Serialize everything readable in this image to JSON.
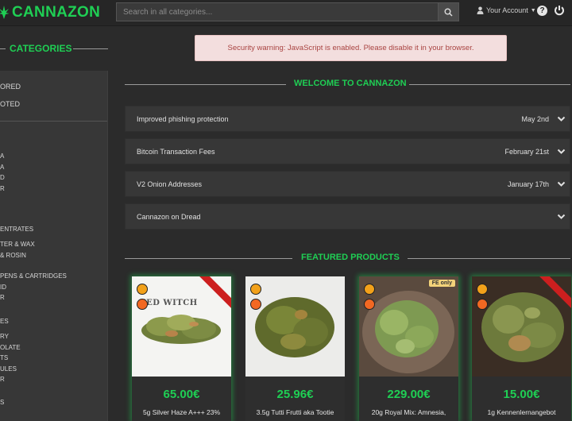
{
  "header": {
    "brand": "CANNAZON",
    "search_placeholder": "Search in all categories...",
    "account_label": "Your Account"
  },
  "sidebar": {
    "title": "CATEGORIES",
    "items": [
      "ORED",
      "OTED",
      "A",
      "A",
      "D",
      "R",
      "ENTRATES",
      "TER & WAX",
      "& ROSIN",
      "PENS & CARTRIDGES",
      "ID",
      "R",
      "ES",
      "RY",
      "OLATE",
      "TS",
      "ULES",
      "R",
      "S"
    ]
  },
  "alert": {
    "text": "Security warning: JavaScript is enabled. Please disable it in your browser."
  },
  "welcome": {
    "title": "WELCOME TO CANNAZON"
  },
  "news": [
    {
      "title": "Improved phishing protection",
      "date": "May 2nd"
    },
    {
      "title": "Bitcoin Transaction Fees",
      "date": "February 21st"
    },
    {
      "title": "V2 Onion Addresses",
      "date": "January 17th"
    },
    {
      "title": "Cannazon on Dread",
      "date": ""
    }
  ],
  "featured": {
    "title": "FEATURED PRODUCTS",
    "products": [
      {
        "price": "65.00€",
        "name": "5g Silver Haze A+++ 23%",
        "image_text": "EED WITCH",
        "highlighted": true
      },
      {
        "price": "25.96€",
        "name": "3.5g Tutti Frutti aka Tootie",
        "image_text": "",
        "highlighted": false
      },
      {
        "price": "229.00€",
        "name": "20g Royal Mix: Amnesia,",
        "image_text": "",
        "highlighted": true,
        "tag": "FE only"
      },
      {
        "price": "15.00€",
        "name": "1g Kennenlernangebot",
        "image_text": "",
        "highlighted": true
      }
    ]
  },
  "colors": {
    "accent": "#1fcf54",
    "background": "#2b2b2b",
    "panel": "#373737",
    "alert_bg": "#f3dede",
    "alert_text": "#a94442"
  }
}
